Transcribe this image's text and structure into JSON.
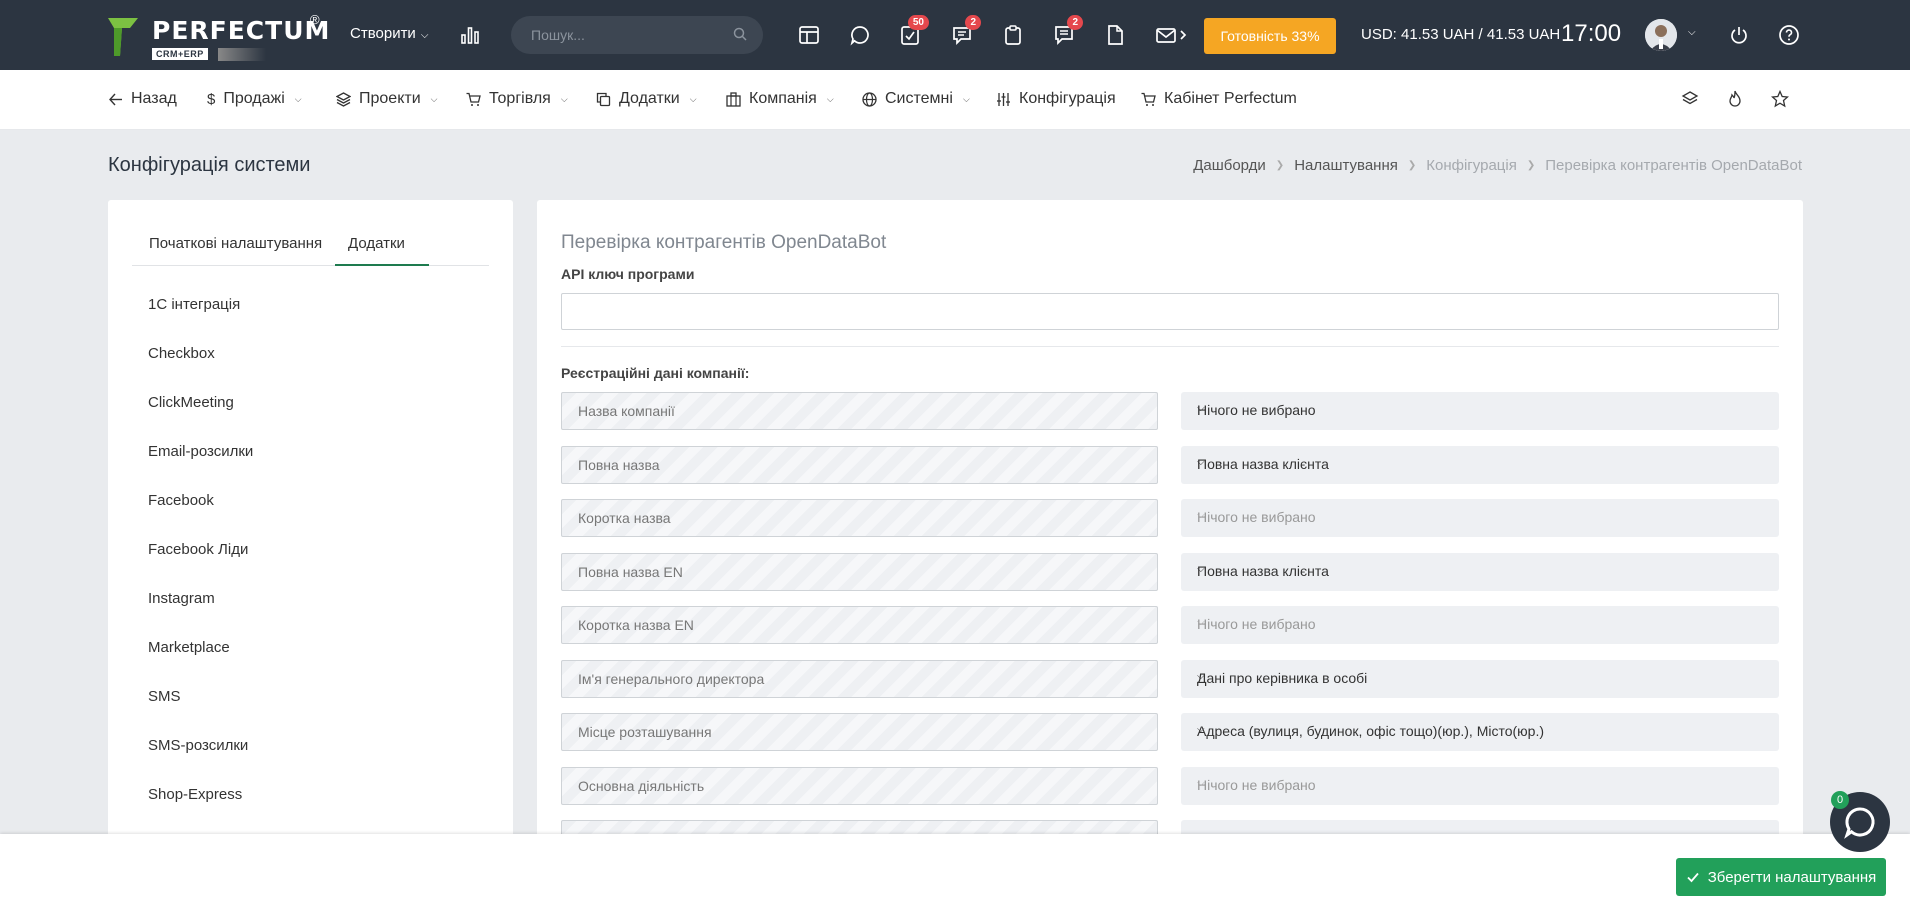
{
  "topbar": {
    "logo_text": "PERFECTUM",
    "logo_reg": "®",
    "logo_sub": "CRM+ERP",
    "create_label": "Створити",
    "search_placeholder": "Пошук...",
    "badges": {
      "tasks": "50",
      "chats": "2",
      "messages": "2"
    },
    "ready_label": "Готовність 33%",
    "currency": "USD: 41.53 UAH / 41.53 UAH",
    "time": "17:00",
    "colors": {
      "bar": "#2c3541",
      "ready": "#f5a623"
    }
  },
  "nav": {
    "back": "Назад",
    "sales": "Продажі",
    "projects": "Проекти",
    "trade": "Торгівля",
    "addons": "Додатки",
    "company": "Компанія",
    "system": "Системні",
    "config": "Конфігурація",
    "cabinet": "Кабінет Perfectum"
  },
  "page": {
    "title": "Конфігурація системи",
    "breadcrumbs": [
      "Дашборди",
      "Налаштування",
      "Конфігурація",
      "Перевірка контрагентів OpenDataBot"
    ]
  },
  "left": {
    "tabs": [
      "Початкові налаштування",
      "Додатки"
    ],
    "items": [
      "1С інтеграція",
      "Checkbox",
      "ClickMeeting",
      "Email-розсилки",
      "Facebook",
      "Facebook Ліди",
      "Instagram",
      "Marketplace",
      "SMS",
      "SMS-розсилки",
      "Shop-Express"
    ]
  },
  "main": {
    "section_title": "Перевірка контрагентів OpenDataBot",
    "api_label": "API ключ програми",
    "api_value": "",
    "reg_label": "Реєстраційні дані компанії:",
    "rows": [
      {
        "field": "Назва компанії",
        "select": "Нічого не вибрано",
        "muted": false
      },
      {
        "field": "Повна назва",
        "select": "Повна назва клієнта",
        "muted": false
      },
      {
        "field": "Коротка назва",
        "select": "Нічого не вибрано",
        "muted": true
      },
      {
        "field": "Повна назва EN",
        "select": "Повна назва клієнта",
        "muted": false
      },
      {
        "field": "Коротка назва EN",
        "select": "Нічого не вибрано",
        "muted": true
      },
      {
        "field": "Ім'я генерального директора",
        "select": "Дані про керівника в особі",
        "muted": false
      },
      {
        "field": "Місце розташування",
        "select": "Адреса (вулиця, будинок, офіс тощо)(юр.), Місто(юр.)",
        "muted": false
      },
      {
        "field": "Основна діяльність",
        "select": "Нічого не вибрано",
        "muted": true
      }
    ]
  },
  "footer": {
    "save_label": "Зберегти налаштування",
    "chat_count": "0",
    "save_color": "#22a05a"
  }
}
